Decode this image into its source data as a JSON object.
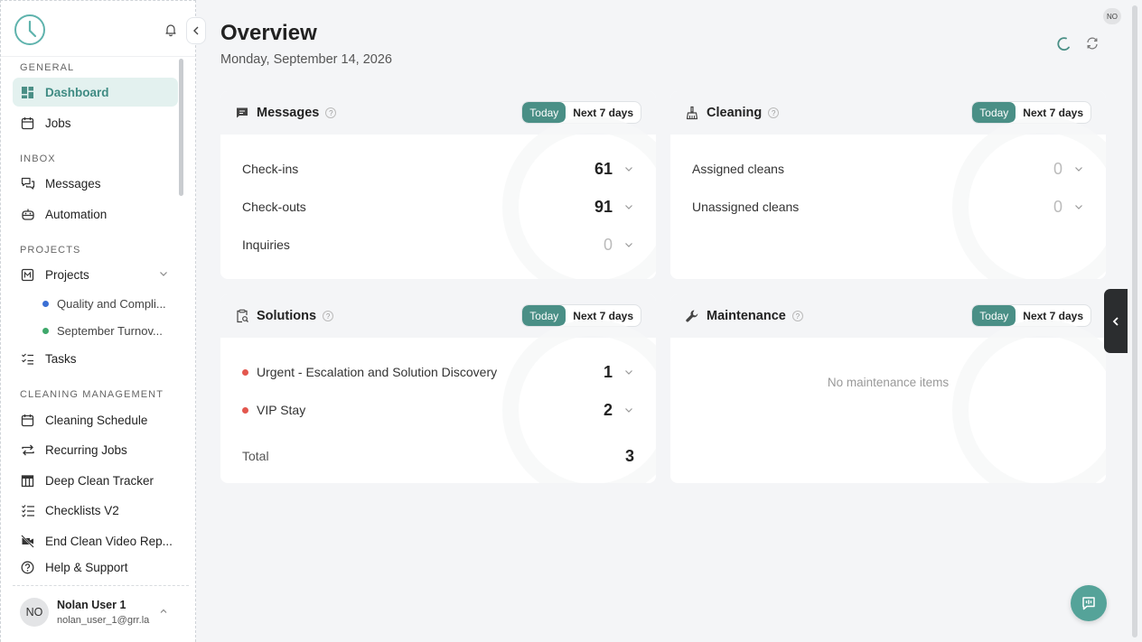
{
  "sidebar": {
    "sections": {
      "general": "GENERAL",
      "inbox": "INBOX",
      "projects": "PROJECTS",
      "cleaning": "CLEANING MANAGEMENT"
    },
    "items": {
      "dashboard": "Dashboard",
      "jobs": "Jobs",
      "messages": "Messages",
      "automation": "Automation",
      "projects": "Projects",
      "tasks": "Tasks",
      "cleaning_schedule": "Cleaning Schedule",
      "recurring_jobs": "Recurring Jobs",
      "deep_clean": "Deep Clean Tracker",
      "checklists": "Checklists V2",
      "end_clean_video": "End Clean Video Rep...",
      "help": "Help & Support"
    },
    "projects": [
      {
        "label": "Quality and Compli...",
        "color": "#3b6fd4"
      },
      {
        "label": "September Turnov...",
        "color": "#3fa86b"
      }
    ],
    "user": {
      "initials": "NO",
      "name": "Nolan User 1",
      "email": "nolan_user_1@grr.la"
    }
  },
  "header": {
    "title": "Overview",
    "date": "Monday, September 14, 2026",
    "badge": "NO"
  },
  "toggle": {
    "today": "Today",
    "next7": "Next 7 days"
  },
  "cards": {
    "messages": {
      "title": "Messages",
      "rows": [
        {
          "label": "Check-ins",
          "value": "61"
        },
        {
          "label": "Check-outs",
          "value": "91"
        },
        {
          "label": "Inquiries",
          "value": "0"
        }
      ]
    },
    "cleaning": {
      "title": "Cleaning",
      "rows": [
        {
          "label": "Assigned cleans",
          "value": "0"
        },
        {
          "label": "Unassigned cleans",
          "value": "0"
        }
      ]
    },
    "solutions": {
      "title": "Solutions",
      "rows": [
        {
          "label": "Urgent - Escalation and Solution Discovery",
          "value": "1"
        },
        {
          "label": "VIP Stay",
          "value": "2"
        }
      ],
      "total_label": "Total",
      "total_value": "3"
    },
    "maintenance": {
      "title": "Maintenance",
      "empty": "No maintenance items"
    }
  },
  "colors": {
    "accent": "#4a8f86",
    "active_bg": "#e3f1ef",
    "alert_dot": "#e3574e"
  }
}
